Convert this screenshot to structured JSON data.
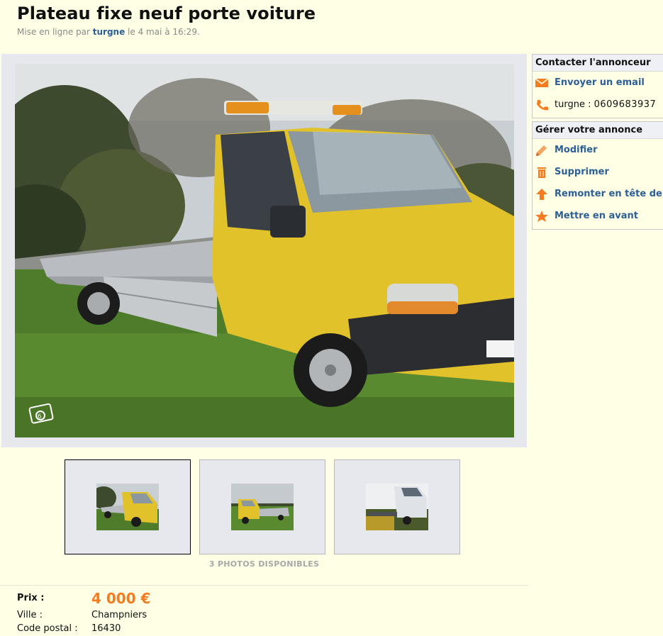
{
  "ad": {
    "title": "Plateau fixe neuf porte voiture",
    "meta_prefix": "Mise en ligne par ",
    "author": "turgne",
    "meta_suffix": " le 4 mai à 16:29."
  },
  "gallery": {
    "photo_count_label": "3 PHOTOS DISPONIBLES",
    "thumbnails": [
      "photo-1",
      "photo-2",
      "photo-3"
    ],
    "selected_index": 0
  },
  "details": {
    "price_label": "Prix :",
    "price_value": "4 000 €",
    "city_label": "Ville :",
    "city_value": "Champniers",
    "postal_label": "Code postal :",
    "postal_value": "16430"
  },
  "contact_panel": {
    "title": "Contacter l'annonceur",
    "email_label": "Envoyer un email",
    "phone_name": "turgne",
    "phone_sep": " : ",
    "phone_number": "0609683937"
  },
  "manage_panel": {
    "title": "Gérer votre annonce",
    "items": [
      {
        "label": "Modifier",
        "icon": "pencil-icon"
      },
      {
        "label": "Supprimer",
        "icon": "trash-icon"
      },
      {
        "label": "Remonter en tête de",
        "icon": "arrow-up-icon"
      },
      {
        "label": "Mettre en avant",
        "icon": "star-icon"
      }
    ]
  },
  "colors": {
    "background": "#ffffe6",
    "link": "#2b5f95",
    "price": "#f47b20",
    "accent_icon": "#f47b20"
  }
}
